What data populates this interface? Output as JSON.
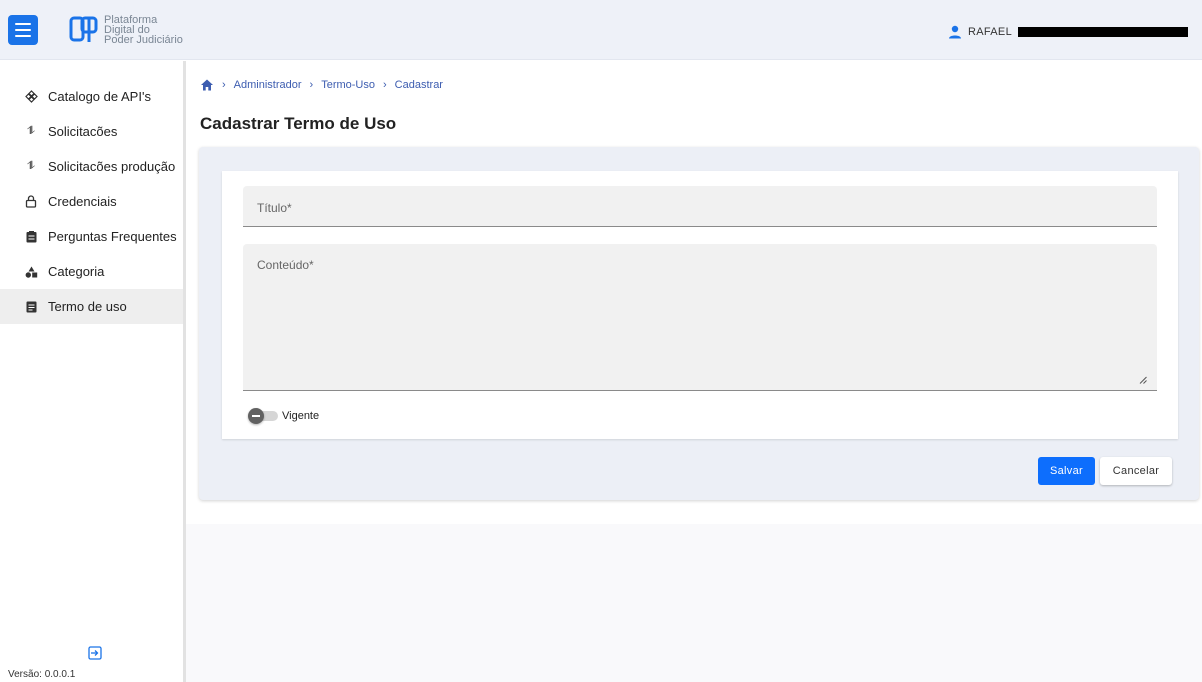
{
  "header": {
    "logo_lines": [
      "Plataforma",
      "Digital do",
      "Poder Judiciário"
    ],
    "user_name": "RAFAEL"
  },
  "sidebar": {
    "items": [
      {
        "label": "Catalogo de API's",
        "icon": "api-catalog-icon"
      },
      {
        "label": "Solicitacões",
        "icon": "requests-icon"
      },
      {
        "label": "Solicitacões produção",
        "icon": "production-requests-icon"
      },
      {
        "label": "Credenciais",
        "icon": "lock-icon"
      },
      {
        "label": "Perguntas Frequentes",
        "icon": "faq-icon"
      },
      {
        "label": "Categoria",
        "icon": "category-icon"
      },
      {
        "label": "Termo de uso",
        "icon": "terms-icon"
      }
    ],
    "active_item": "Termo de uso",
    "version": "Versão: 0.0.0.1"
  },
  "breadcrumb": {
    "items": [
      "Administrador",
      "Termo-Uso",
      "Cadastrar"
    ]
  },
  "page": {
    "title": "Cadastrar Termo de Uso"
  },
  "form": {
    "title_label": "Título*",
    "title_value": "",
    "content_label": "Conteúdo*",
    "content_value": "",
    "toggle_label": "Vigente",
    "toggle_on": false,
    "save_label": "Salvar",
    "cancel_label": "Cancelar"
  },
  "colors": {
    "accent": "#1a73e8",
    "primary_button": "#0d6efd",
    "link": "#3d5db0",
    "header_bg": "#eef1f8"
  }
}
